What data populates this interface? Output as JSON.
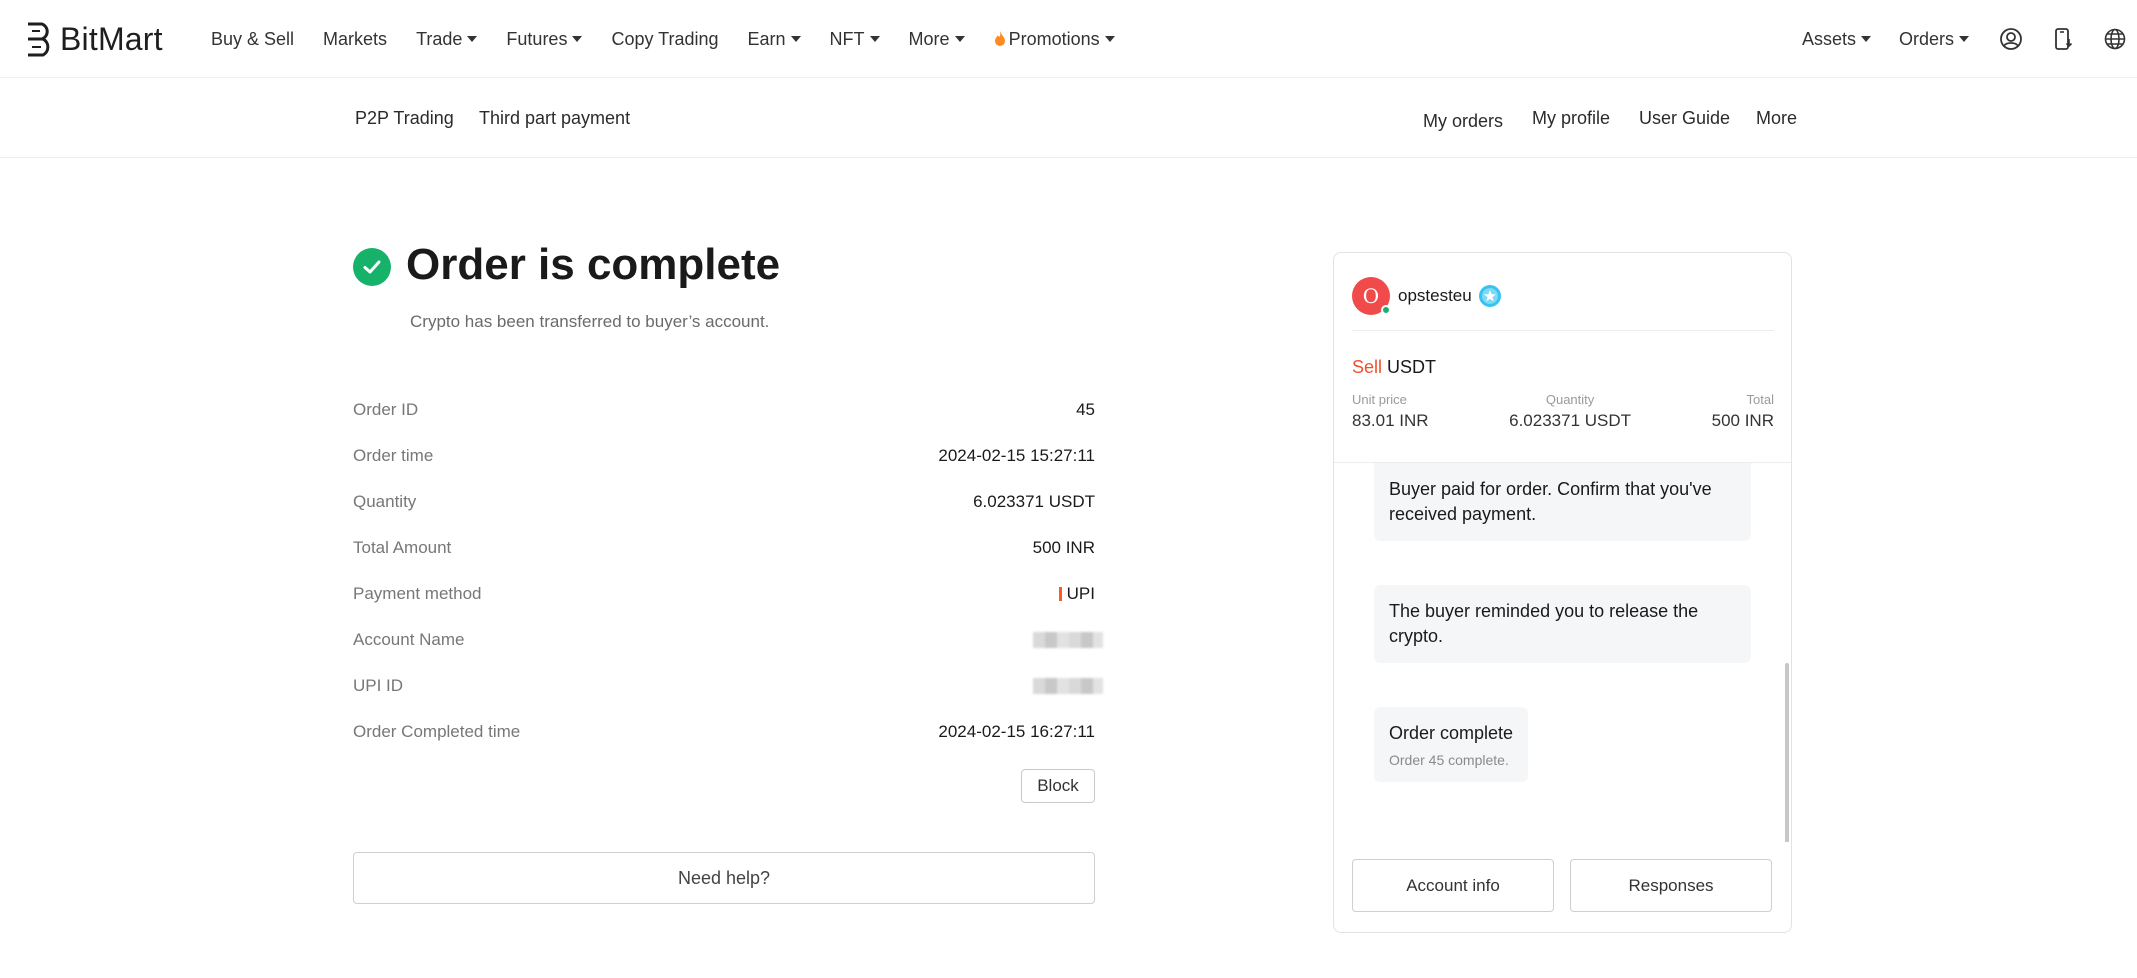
{
  "brand": {
    "name": "BitMart"
  },
  "topnav": {
    "items": [
      {
        "label": "Buy & Sell",
        "dropdown": false
      },
      {
        "label": "Markets",
        "dropdown": false
      },
      {
        "label": "Trade",
        "dropdown": true
      },
      {
        "label": "Futures",
        "dropdown": true
      },
      {
        "label": "Copy Trading",
        "dropdown": false
      },
      {
        "label": "Earn",
        "dropdown": true
      },
      {
        "label": "NFT",
        "dropdown": true
      },
      {
        "label": "More",
        "dropdown": true
      },
      {
        "label": "Promotions",
        "dropdown": true
      }
    ],
    "right": {
      "assets": "Assets",
      "orders": "Orders"
    },
    "icons": [
      "user-account-icon",
      "download-app-icon",
      "language-globe-icon"
    ]
  },
  "subnav": {
    "left": [
      "P2P Trading",
      "Third part payment"
    ],
    "right": [
      "My orders",
      "My profile",
      "User Guide",
      "More"
    ]
  },
  "order": {
    "title": "Order is complete",
    "subtitle": "Crypto has been transferred to buyer’s account.",
    "details": [
      {
        "label": "Order ID",
        "value": "45"
      },
      {
        "label": "Order time",
        "value": "2024-02-15 15:27:11"
      },
      {
        "label": "Quantity",
        "value": "6.023371 USDT"
      },
      {
        "label": "Total Amount",
        "value": "500 INR"
      },
      {
        "label": "Payment method",
        "value": "UPI"
      },
      {
        "label": "Account Name",
        "value": ""
      },
      {
        "label": "UPI ID",
        "value": ""
      },
      {
        "label": "Order Completed time",
        "value": "2024-02-15 16:27:11"
      }
    ],
    "block_label": "Block",
    "help_label": "Need help?"
  },
  "panel": {
    "avatar_letter": "O",
    "username": "opstesteu",
    "trade_side": "Sell",
    "trade_asset": "USDT",
    "unit_price_label": "Unit price",
    "unit_price": "83.01 INR",
    "quantity_label": "Quantity",
    "quantity": "6.023371 USDT",
    "total_label": "Total",
    "total": "500 INR",
    "messages": [
      {
        "text": "Buyer paid for order. Confirm that you've received payment.",
        "sub": ""
      },
      {
        "text": "The buyer reminded you to release the crypto.",
        "sub": ""
      },
      {
        "text": "Order complete",
        "sub": "Order 45 complete."
      }
    ],
    "account_info_label": "Account info",
    "responses_label": "Responses"
  },
  "colors": {
    "accent_green": "#17b26a",
    "sell_red": "#f0502e",
    "avatar_red": "#f04a4a"
  }
}
